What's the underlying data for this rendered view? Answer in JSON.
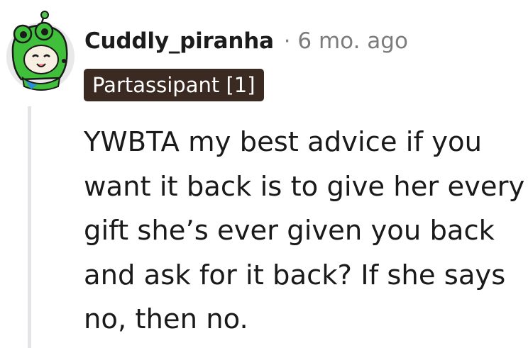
{
  "comment": {
    "username": "Cuddly_piranha",
    "separator": "·",
    "timestamp": "6 mo. ago",
    "flair": "Partassipant [1]",
    "body": "YWBTA my best advice if you want it back is to give her every gift she’s ever given you back and ask for it back? If she says no, then no."
  },
  "colors": {
    "flair_background": "#3b2a22",
    "flair_text": "#ffffff",
    "meta_text": "#7c7c7c",
    "thread_line": "#e4e4e6",
    "avatar_green": "#3fbf3a"
  },
  "icons": {
    "avatar": "snoo-frog-hat-avatar"
  }
}
